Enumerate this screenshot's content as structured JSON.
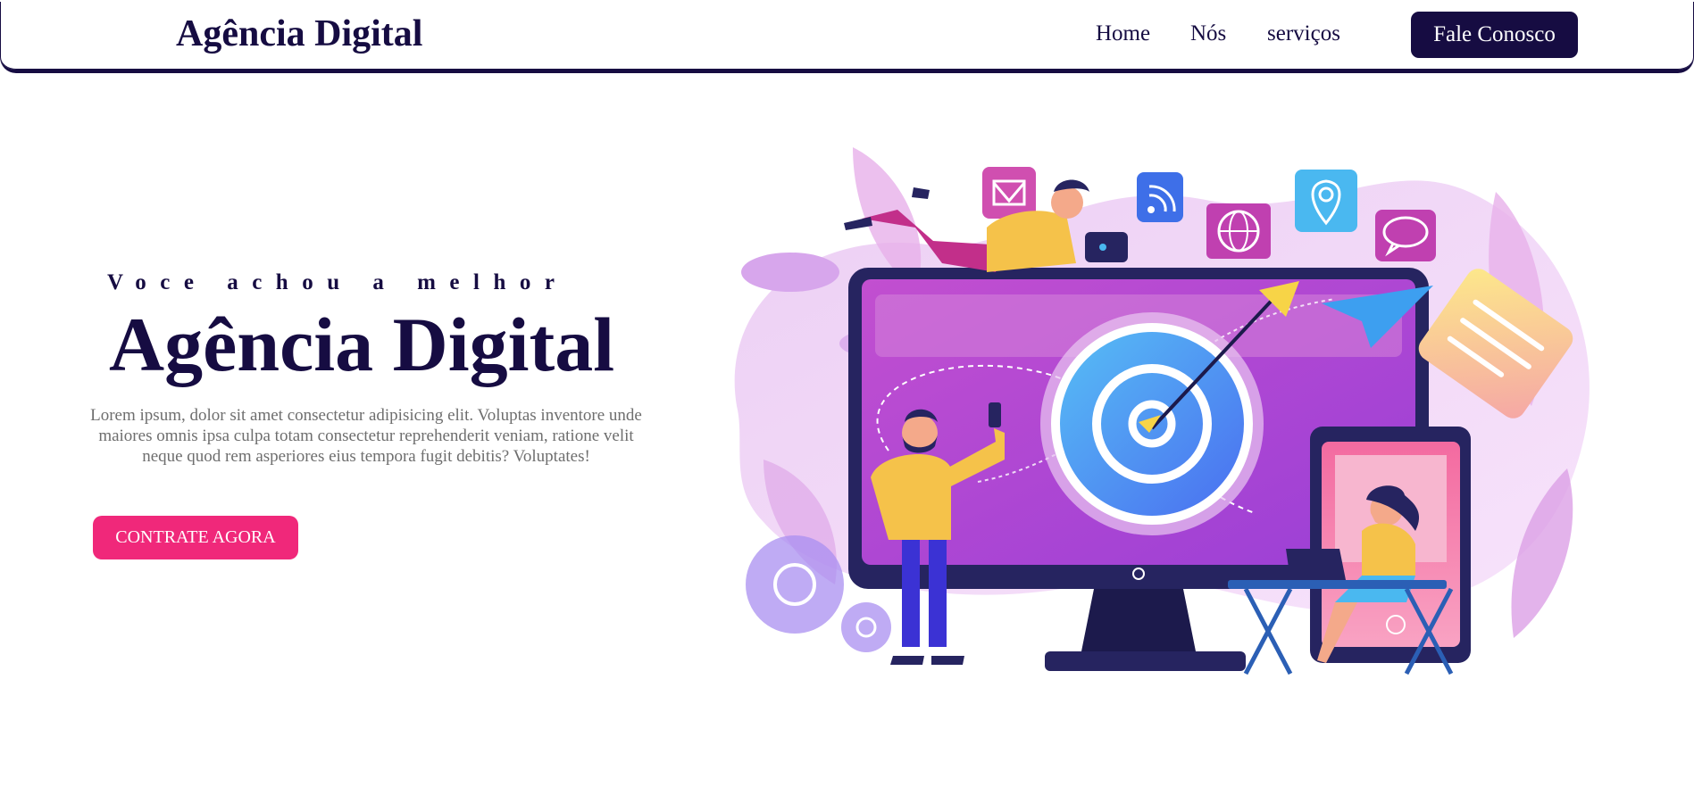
{
  "header": {
    "logo": "Agência Digital",
    "nav": [
      "Home",
      "Nós",
      "serviços"
    ],
    "cta": "Fale Conosco"
  },
  "hero": {
    "eyebrow": "Voce achou a melhor",
    "title": "Agência Digital",
    "description": "Lorem ipsum, dolor sit amet consectetur adipisicing elit. Voluptas inventore unde maiores omnis ipsa culpa totam consectetur reprehenderit veniam, ratione velit neque quod rem asperiores eius tempora fugit debitis? Voluptates!",
    "cta": "CONTRATE AGORA"
  },
  "illustration": {
    "icons": [
      "mail-icon",
      "rss-icon",
      "globe-icon",
      "location-pin-icon",
      "chat-icon",
      "paper-plane-icon",
      "gear-icon",
      "target-icon"
    ]
  },
  "colors": {
    "primary": "#160c42",
    "accent": "#f0287a",
    "text_muted": "#6e6e6e"
  }
}
